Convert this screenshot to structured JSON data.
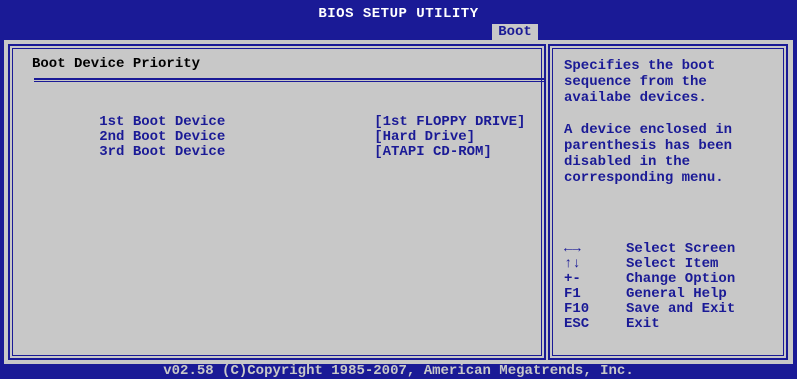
{
  "header": {
    "title": "BIOS SETUP UTILITY",
    "active_tab": "Boot"
  },
  "main": {
    "section_title": "Boot Device Priority",
    "boot_devices": [
      {
        "label": "1st Boot Device",
        "value": "[1st FLOPPY DRIVE]"
      },
      {
        "label": "2nd Boot Device",
        "value": "[Hard Drive]"
      },
      {
        "label": "3rd Boot Device",
        "value": "[ATAPI CD-ROM]"
      }
    ]
  },
  "help": {
    "description_1": "Specifies the boot sequence from the availabe devices.",
    "description_2": "A device enclosed in parenthesis has been disabled in the corresponding menu.",
    "keys": [
      {
        "key": "←→",
        "desc": "Select Screen"
      },
      {
        "key": "↑↓",
        "desc": "Select Item"
      },
      {
        "key": "+-",
        "desc": "Change Option"
      },
      {
        "key": "F1",
        "desc": "General Help"
      },
      {
        "key": "F10",
        "desc": "Save and Exit"
      },
      {
        "key": "ESC",
        "desc": "Exit"
      }
    ]
  },
  "footer": {
    "text": "v02.58 (C)Copyright 1985-2007, American Megatrends, Inc."
  },
  "colors": {
    "background": "#1a1a96",
    "panel": "#c8c8c8",
    "text_dark": "#1a1a96",
    "highlight_text": "#ffffff"
  }
}
